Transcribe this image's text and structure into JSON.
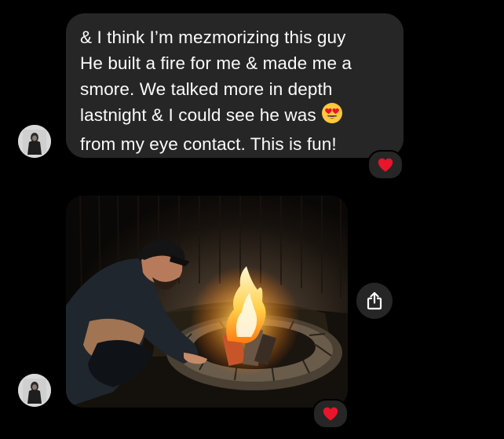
{
  "message": {
    "lines": [
      "& I think I’m mezmorizing this guy",
      "He built a fire for me & made me a",
      "smore. We talked more in depth",
      "lastnight & I could see he was",
      "from my eye contact. This is fun!"
    ],
    "emoji": "heart-eyes-emoji"
  },
  "reactions": {
    "text_message": "red-heart",
    "photo_message": "red-heart"
  },
  "icons": {
    "avatar": "profile-avatar",
    "share": "share-icon"
  },
  "colors": {
    "background": "#000000",
    "bubble": "#262626",
    "text": "#ffffff",
    "heart": "#e8152b",
    "emoji_face": "#ffc83d"
  }
}
